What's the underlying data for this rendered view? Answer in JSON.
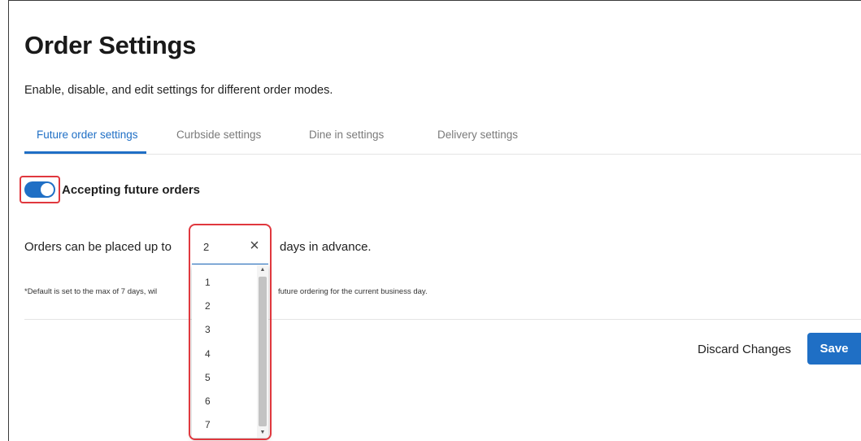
{
  "page": {
    "title": "Order Settings",
    "subtitle": "Enable, disable, and edit settings for different order modes."
  },
  "tabs": [
    {
      "label": "Future order settings",
      "active": true
    },
    {
      "label": "Curbside settings",
      "active": false
    },
    {
      "label": "Dine in settings",
      "active": false
    },
    {
      "label": "Delivery settings",
      "active": false
    }
  ],
  "toggle": {
    "label": "Accepting future orders",
    "on": true
  },
  "advance": {
    "prefix": "Orders can be placed up to",
    "selected_value": "2",
    "suffix": "days in advance.",
    "options": [
      "1",
      "2",
      "3",
      "4",
      "5",
      "6",
      "7"
    ]
  },
  "footnote": {
    "part_a": "*Default is set to the max of 7 days, wil",
    "part_b": "future ordering for the current business day."
  },
  "actions": {
    "discard_label": "Discard Changes",
    "save_label": "Save"
  },
  "colors": {
    "accent": "#1f6fc5",
    "highlight": "#e0383e"
  },
  "icons": {
    "clear": "close-icon",
    "scroll_up": "scroll-up-arrow-icon",
    "scroll_down": "scroll-down-arrow-icon"
  }
}
